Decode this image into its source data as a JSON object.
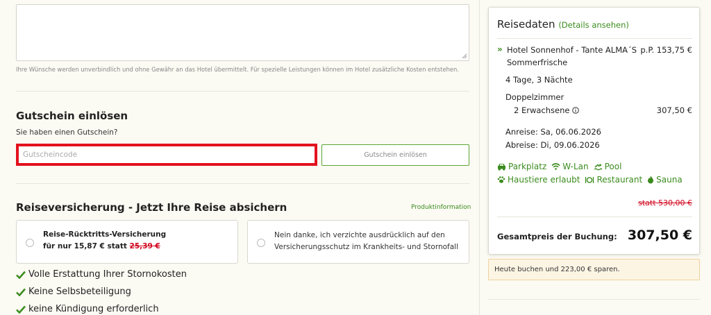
{
  "wishes": {
    "textarea_value": "",
    "hint": "Ihre Wünsche werden unverbindlich und ohne Gewähr an das Hotel übermittelt. Für spezielle Leistungen können im Hotel zusätzliche Kosten entstehen."
  },
  "voucher": {
    "title": "Gutschein einlösen",
    "question": "Sie haben einen Gutschein?",
    "placeholder": "Gutscheincode",
    "button_label": "Gutschein einlösen"
  },
  "insurance": {
    "title": "Reiseversicherung - Jetzt Ihre Reise absichern",
    "product_info": "Produktinformation",
    "option_yes": {
      "title": "Reise-Rücktritts-Versicherung",
      "price_prefix": "für nur 15,87 € statt",
      "old_price": "25,39 €"
    },
    "option_no": {
      "text": "Nein danke, ich verzichte ausdrücklich auf den Versicherungsschutz im Krankheits- und Stornofall"
    },
    "benefits": [
      "Volle Erstattung Ihrer Stornokosten",
      "Keine Selbsbeteiligung",
      "keine Kündigung erforderlich"
    ]
  },
  "travel": {
    "title": "Reisedaten",
    "details_link": "(Details ansehen)",
    "hotel_line1": "Hotel Sonnenhof - Tante ALMA´S",
    "hotel_line2": "Sommerfrische",
    "per_person": "p.P. 153,75 €",
    "duration": "4 Tage, 3 Nächte",
    "room": "Doppelzimmer",
    "guests": "2 Erwachsene",
    "room_price": "307,50 €",
    "arrival": "Anreise: Sa, 06.06.2026",
    "departure": "Abreise: Di, 09.06.2026",
    "amenities": {
      "parking": "Parkplatz",
      "wifi": "W-Lan",
      "pool": "Pool",
      "pets": "Haustiere erlaubt",
      "restaurant": "Restaurant",
      "sauna": "Sauna"
    },
    "old_price": "statt 530,00 €",
    "total_label": "Gesamtpreis der Buchung:",
    "total_value": "307,50 €",
    "savings_note": "Heute buchen und 223,00 € sparen."
  },
  "colors": {
    "accent_green": "#3b8c1e",
    "highlight_red": "#e3121e",
    "strike_red": "#d0021b",
    "page_bg": "#fbfaf3"
  }
}
